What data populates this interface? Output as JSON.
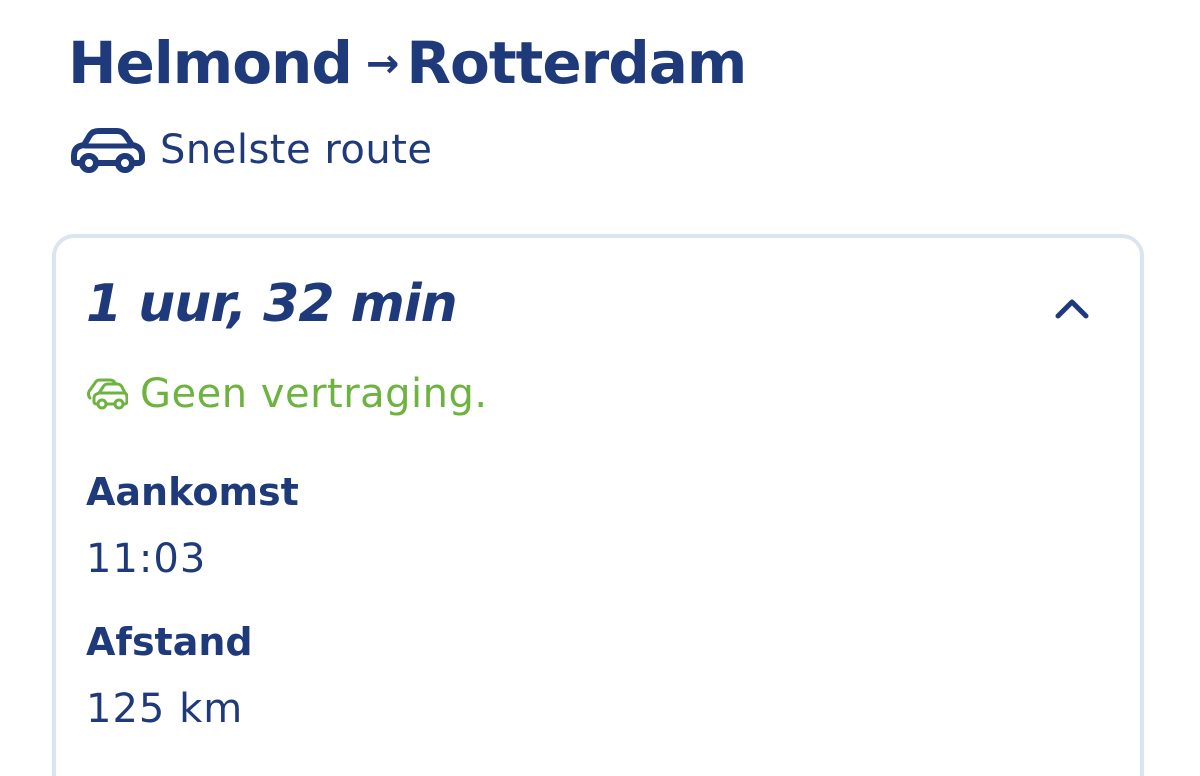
{
  "route": {
    "from": "Helmond",
    "arrow": "→",
    "to": "Rotterdam",
    "type_label": "Snelste route",
    "type_icon": "car-icon"
  },
  "summary": {
    "duration": "1 uur, 32 min",
    "collapse_icon": "chevron-up-icon",
    "traffic_icon": "traffic-cars-icon",
    "traffic_status": "Geen vertraging.",
    "traffic_color": "#6db33f",
    "arrival_label": "Aankomst",
    "arrival_value": "11:03",
    "distance_label": "Afstand",
    "distance_value": "125 km"
  },
  "colors": {
    "primary": "#1f3a7a",
    "card_border": "#dbe5f1",
    "success": "#6db33f"
  }
}
